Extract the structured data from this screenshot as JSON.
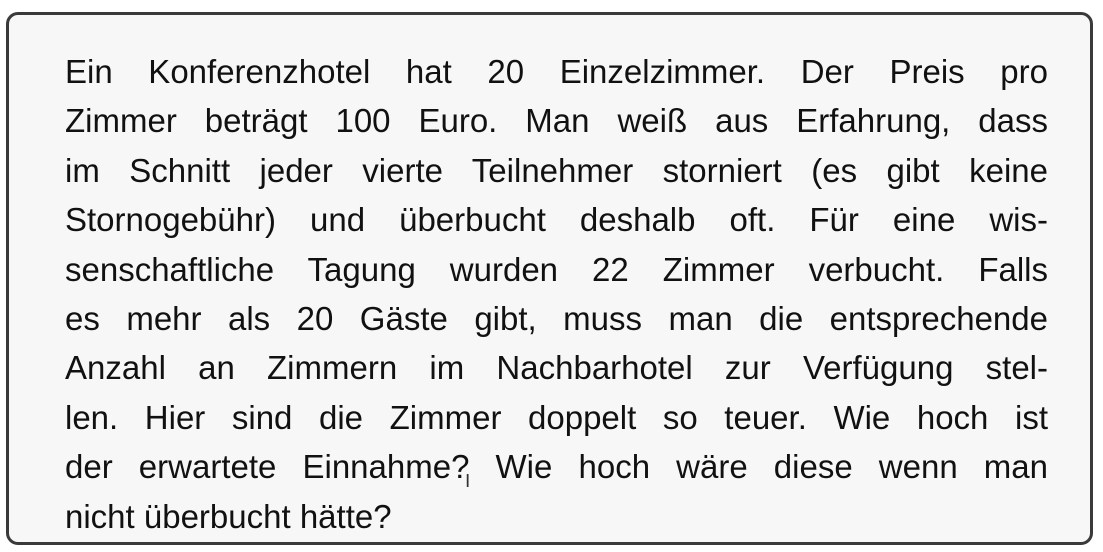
{
  "task": {
    "lines": [
      "Ein Konferenzhotel hat 20 Einzelzimmer. Der Preis pro",
      "Zimmer beträgt 100 Euro. Man weiß aus Erfahrung, dass",
      "im Schnitt jeder vierte Teilnehmer storniert (es gibt keine",
      "Stornogebühr) und überbucht deshalb oft. Für eine wis-",
      "senschaftliche Tagung wurden 22 Zimmer verbucht. Falls",
      "es mehr als 20 Gäste gibt, muss man die entsprechende",
      "Anzahl an Zimmern im Nachbarhotel zur Verfügung stel-",
      "len. Hier sind die Zimmer doppelt so teuer. Wie hoch ist",
      "der erwartete Einnahme? Wie hoch wäre diese wenn man",
      "nicht überbucht hätte?"
    ]
  },
  "cursor": {
    "icon": "text-cursor-icon",
    "glyph": "I"
  },
  "colors": {
    "border": "#3a3a3a",
    "box_background": "#f7f7f7",
    "text": "#111111"
  }
}
